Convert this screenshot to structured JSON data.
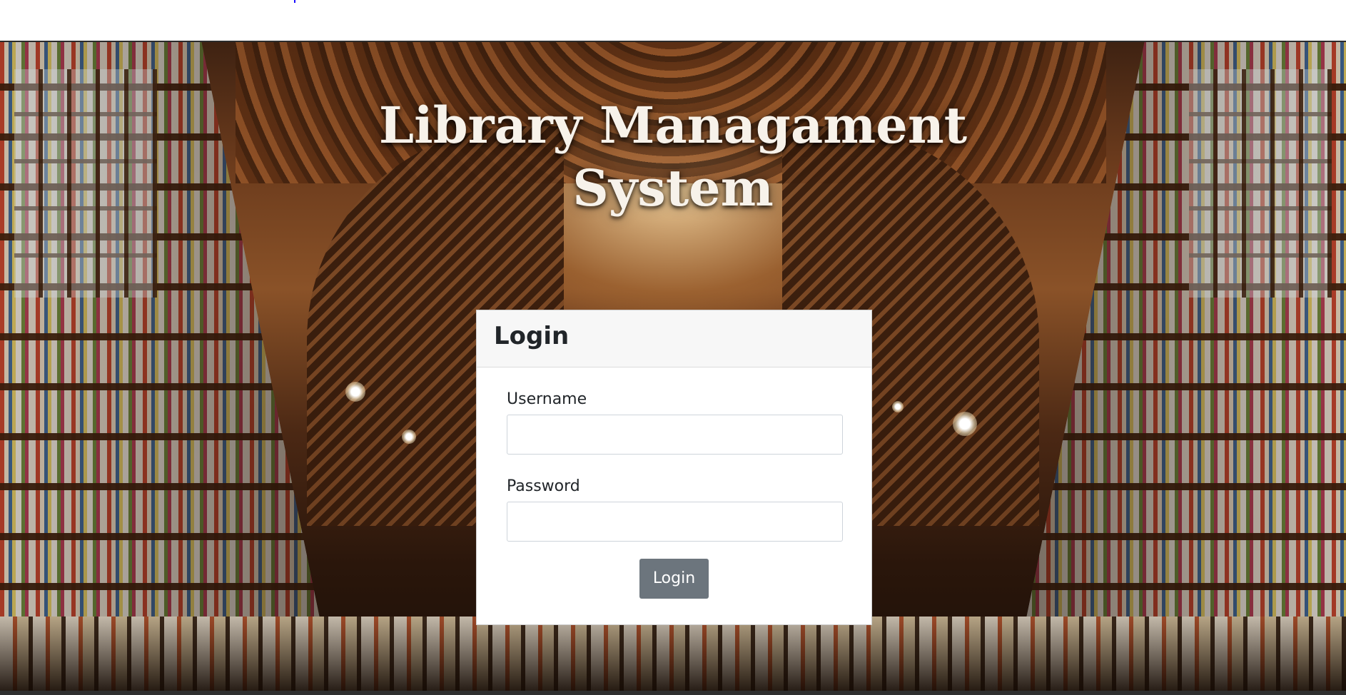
{
  "page": {
    "title_line1": "Library Managament",
    "title_line2": "System"
  },
  "login_card": {
    "header": "Login",
    "username_label": "Username",
    "username_value": "",
    "password_label": "Password",
    "password_value": "",
    "submit_label": "Login"
  },
  "colors": {
    "button_bg": "#6c757d",
    "card_header_bg": "#f7f7f7",
    "title_text": "#f7f2ea"
  }
}
